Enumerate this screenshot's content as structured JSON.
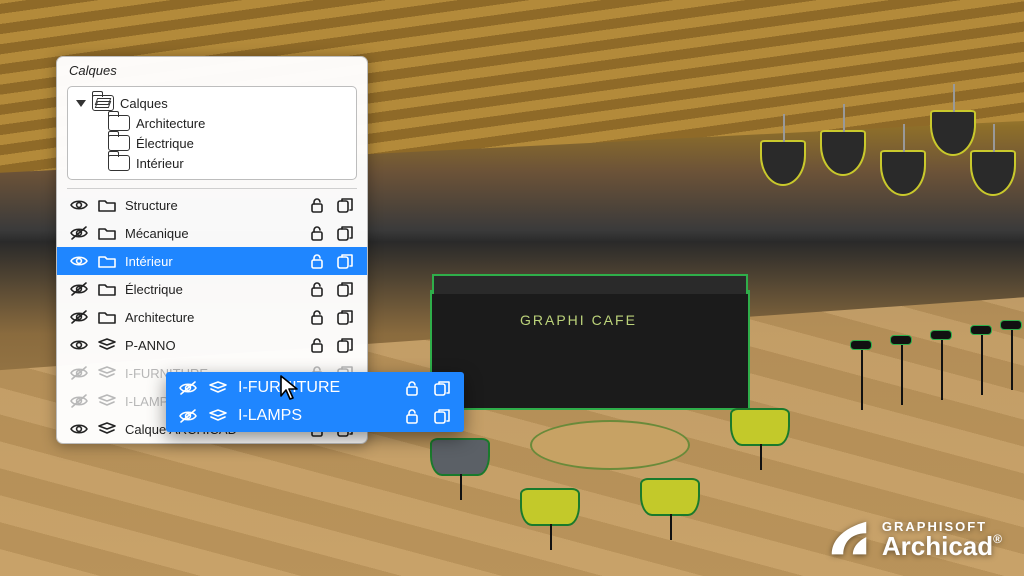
{
  "viewport": {
    "sign_text": "GRAPHI CAFE"
  },
  "palette": {
    "title": "Calques",
    "tree": {
      "root_label": "Calques",
      "children": [
        {
          "label": "Architecture"
        },
        {
          "label": "Électrique"
        },
        {
          "label": "Intérieur"
        }
      ]
    },
    "rows": [
      {
        "visible": true,
        "hidden": false,
        "type": "folder",
        "label": "Structure",
        "selected": false,
        "dim": false
      },
      {
        "visible": false,
        "hidden": true,
        "type": "folder",
        "label": "Mécanique",
        "selected": false,
        "dim": false
      },
      {
        "visible": true,
        "hidden": false,
        "type": "folder",
        "label": "Intérieur",
        "selected": true,
        "dim": false
      },
      {
        "visible": false,
        "hidden": true,
        "type": "folder",
        "label": "Électrique",
        "selected": false,
        "dim": false
      },
      {
        "visible": false,
        "hidden": true,
        "type": "folder",
        "label": "Architecture",
        "selected": false,
        "dim": false
      },
      {
        "visible": true,
        "hidden": false,
        "type": "layer",
        "label": "P-ANNO",
        "selected": false,
        "dim": false
      },
      {
        "visible": false,
        "hidden": true,
        "type": "layer",
        "label": "I-FURNITURE",
        "selected": false,
        "dim": true
      },
      {
        "visible": false,
        "hidden": true,
        "type": "layer",
        "label": "I-LAMPS",
        "selected": false,
        "dim": true
      },
      {
        "visible": true,
        "hidden": false,
        "type": "layer",
        "label": "Calque ARCHICAD",
        "selected": false,
        "dim": false
      }
    ]
  },
  "flyout": {
    "rows": [
      {
        "label": "I-FURNITURE"
      },
      {
        "label": "I-LAMPS"
      }
    ]
  },
  "brand": {
    "line1": "GRAPHISOFT",
    "line2": "Archicad",
    "reg": "®"
  }
}
